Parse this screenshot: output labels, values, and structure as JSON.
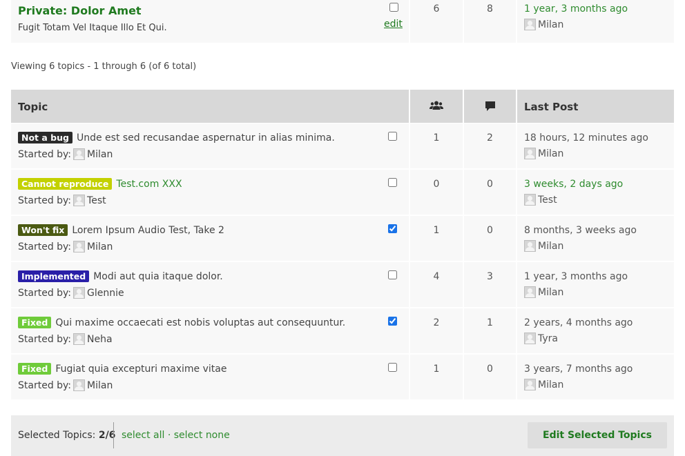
{
  "forum_row": {
    "title": "Private: Dolor Amet",
    "description": "Fugit Totam Vel Itaque Illo Et Qui.",
    "checked": false,
    "edit_label": "edit",
    "voices": "6",
    "replies": "8",
    "freshness": "1 year, 3 months ago",
    "author": "Milan"
  },
  "pagination": {
    "viewing_text": "Viewing 6 topics - 1 through 6 (of 6 total)"
  },
  "table_header": {
    "topic": "Topic",
    "voices_icon": "users-icon",
    "replies_icon": "speech-bubble-icon",
    "last_post": "Last Post"
  },
  "started_by_label": "Started by:",
  "topics": [
    {
      "badge": "Not a bug",
      "badge_color": "#2b2b2b",
      "title": "Unde est sed recusandae aspernatur in alias minima.",
      "title_link": false,
      "author": "Milan",
      "checked": false,
      "voices": "1",
      "replies": "2",
      "freshness": "18 hours, 12 minutes ago",
      "freshness_link": false,
      "last_author": "Milan"
    },
    {
      "badge": "Cannot reproduce",
      "badge_color": "#c3d100",
      "title": "Test.com XXX",
      "title_link": true,
      "author": "Test",
      "checked": false,
      "voices": "0",
      "replies": "0",
      "freshness": "3 weeks, 2 days ago",
      "freshness_link": true,
      "last_author": "Test"
    },
    {
      "badge": "Won't fix",
      "badge_color": "#4b5a12",
      "title": "Lorem Ipsum Audio Test, Take 2",
      "title_link": false,
      "author": "Milan",
      "checked": true,
      "voices": "1",
      "replies": "0",
      "freshness": "8 months, 3 weeks ago",
      "freshness_link": false,
      "last_author": "Milan"
    },
    {
      "badge": "Implemented",
      "badge_color": "#2a1fa8",
      "title": "Modi aut quia itaque dolor.",
      "title_link": false,
      "author": "Glennie",
      "checked": false,
      "voices": "4",
      "replies": "3",
      "freshness": "1 year, 3 months ago",
      "freshness_link": false,
      "last_author": "Milan"
    },
    {
      "badge": "Fixed",
      "badge_color": "#6fcb3a",
      "title": "Qui maxime occaecati est nobis voluptas aut consequuntur.",
      "title_link": false,
      "author": "Neha",
      "checked": true,
      "voices": "2",
      "replies": "1",
      "freshness": "2 years, 4 months ago",
      "freshness_link": false,
      "last_author": "Tyra"
    },
    {
      "badge": "Fixed",
      "badge_color": "#6fcb3a",
      "title": "Fugiat quia excepturi maxime vitae",
      "title_link": false,
      "author": "Milan",
      "checked": false,
      "voices": "1",
      "replies": "0",
      "freshness": "3 years, 7 months ago",
      "freshness_link": false,
      "last_author": "Milan"
    }
  ],
  "footer": {
    "selected_label": "Selected Topics:",
    "selected_count": "2/6",
    "select_all": "select all",
    "separator": "·",
    "select_none": "select none",
    "edit_button": "Edit Selected Topics"
  }
}
